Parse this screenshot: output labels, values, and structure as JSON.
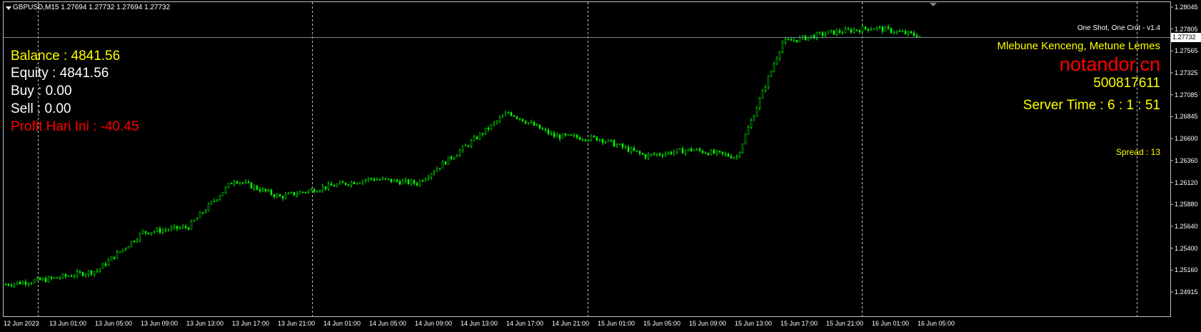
{
  "header": {
    "symbol_ohlc": "GBPUSD,M15  1.27694 1.27732 1.27694 1.27732"
  },
  "account": {
    "balance": "Balance : 4841.56",
    "equity": "Equity : 4841.56",
    "buy": "Buy : 0.00",
    "sell": "Sell : 0.00",
    "profit_today": "Profit Hari Ini : -40.45"
  },
  "ea_panel": {
    "name": "One Shot, One Crot - v1.4",
    "tagline": "Mlebune Kenceng, Metune Lemes",
    "brand": "notandor.cn",
    "account_number": "500817611",
    "server_time": "Server Time : 6 : 1 : 51",
    "spread": "Spread : 13"
  },
  "price_axis": {
    "current_price": "1.27732",
    "ticks": [
      "1.28045",
      "1.27805",
      "1.27565",
      "1.27325",
      "1.27085",
      "1.26845",
      "1.26600",
      "1.26360",
      "1.26120",
      "1.25880",
      "1.25640",
      "1.25400",
      "1.25160",
      "1.24915"
    ]
  },
  "time_axis": {
    "ticks": [
      "12 Jun 2023",
      "13 Jun 01:00",
      "13 Jun 05:00",
      "13 Jun 09:00",
      "13 Jun 13:00",
      "13 Jun 17:00",
      "13 Jun 21:00",
      "14 Jun 01:00",
      "14 Jun 05:00",
      "14 Jun 09:00",
      "14 Jun 13:00",
      "14 Jun 17:00",
      "14 Jun 21:00",
      "15 Jun 01:00",
      "15 Jun 05:00",
      "15 Jun 09:00",
      "15 Jun 13:00",
      "15 Jun 17:00",
      "15 Jun 21:00",
      "16 Jun 01:00",
      "16 Jun 05:00"
    ]
  },
  "colors": {
    "background": "#000000",
    "candle": "#00ff00",
    "bid_line": "#778899",
    "grid": "#c0c0c0",
    "profit_negative": "#ff0000",
    "highlight": "#ffff00"
  },
  "chart_data": {
    "type": "candlestick",
    "symbol": "GBPUSD",
    "timeframe": "M15",
    "ylim": [
      1.249,
      1.2806
    ],
    "x": [
      "12 Jun 2023",
      "13 Jun 01:00",
      "13 Jun 05:00",
      "13 Jun 09:00",
      "13 Jun 13:00",
      "13 Jun 17:00",
      "13 Jun 21:00",
      "14 Jun 01:00",
      "14 Jun 05:00",
      "14 Jun 09:00",
      "14 Jun 13:00",
      "14 Jun 17:00",
      "14 Jun 21:00",
      "15 Jun 01:00",
      "15 Jun 05:00",
      "15 Jun 09:00",
      "15 Jun 13:00",
      "15 Jun 17:00",
      "15 Jun 21:00",
      "16 Jun 01:00",
      "16 Jun 05:00"
    ],
    "close": [
      1.25,
      1.2506,
      1.2515,
      1.2557,
      1.2563,
      1.2615,
      1.2596,
      1.2607,
      1.2616,
      1.2611,
      1.2649,
      1.2689,
      1.2663,
      1.266,
      1.2641,
      1.2648,
      1.264,
      1.2766,
      1.2776,
      1.2782,
      1.2773
    ],
    "bid_price": 1.27732,
    "grid": true
  }
}
